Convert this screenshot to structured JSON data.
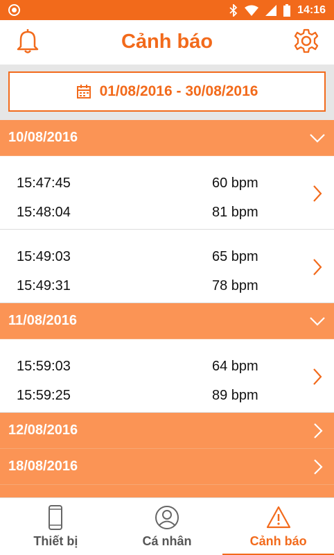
{
  "status_bar": {
    "time": "14:16"
  },
  "header": {
    "title": "Cảnh báo"
  },
  "filter": {
    "date_range": "01/08/2016 - 30/08/2016"
  },
  "groups": [
    {
      "date": "10/08/2016",
      "expanded": true,
      "entries": [
        {
          "time1": "15:47:45",
          "value1": "60 bpm",
          "time2": "15:48:04",
          "value2": "81 bpm"
        },
        {
          "time1": "15:49:03",
          "value1": "65 bpm",
          "time2": "15:49:31",
          "value2": "78 bpm"
        }
      ]
    },
    {
      "date": "11/08/2016",
      "expanded": true,
      "entries": [
        {
          "time1": "15:59:03",
          "value1": "64 bpm",
          "time2": "15:59:25",
          "value2": "89 bpm"
        }
      ]
    },
    {
      "date": "12/08/2016",
      "expanded": false
    },
    {
      "date": "18/08/2016",
      "expanded": false
    }
  ],
  "tabs": [
    {
      "label": "Thiết bị",
      "icon": "phone-icon",
      "active": false
    },
    {
      "label": "Cá nhân",
      "icon": "person-icon",
      "active": false
    },
    {
      "label": "Cảnh báo",
      "icon": "warning-icon",
      "active": true
    }
  ],
  "colors": {
    "accent": "#f26a1b",
    "group_header": "#fb9455"
  }
}
